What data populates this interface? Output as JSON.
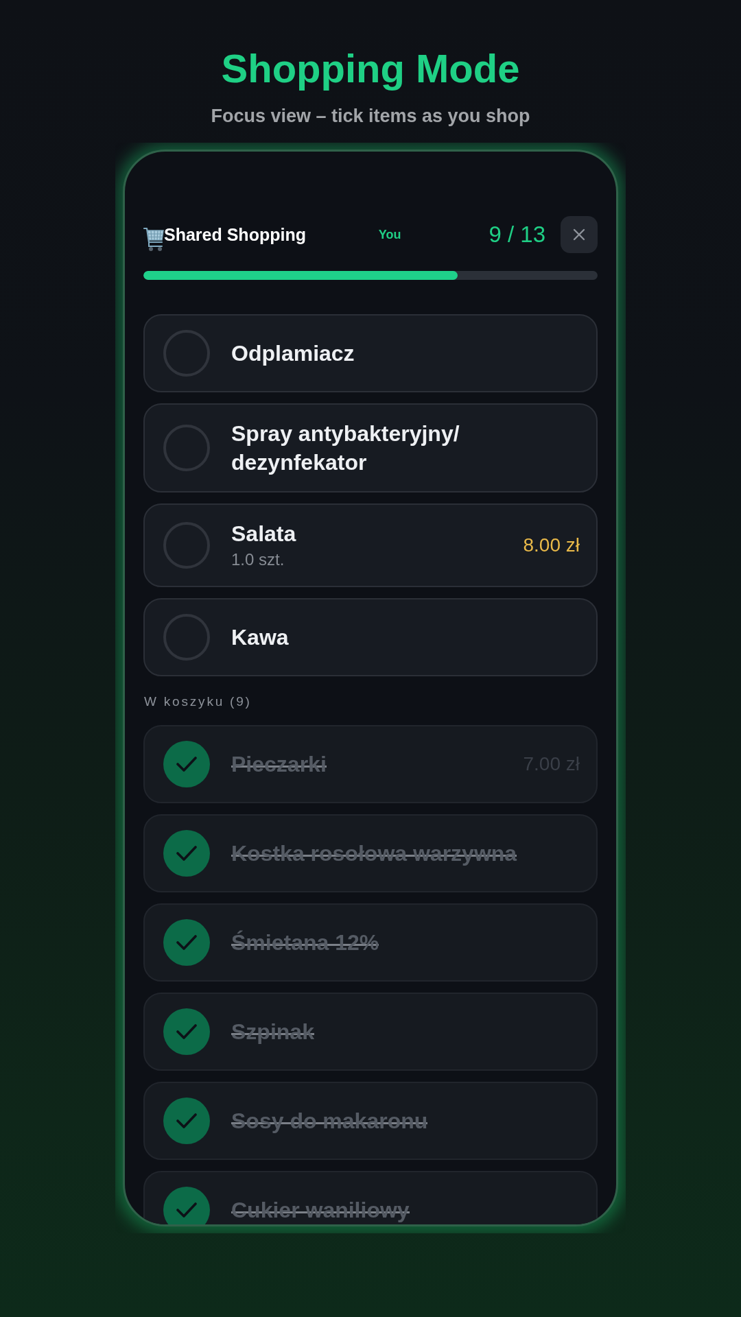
{
  "page": {
    "title": "Shopping Mode",
    "subtitle": "Focus view – tick items as you shop"
  },
  "header": {
    "title": "Shared Shopping",
    "user": "You",
    "count": "9 / 13",
    "progress": {
      "level": 0.692
    }
  },
  "to_buy": [
    {
      "name": "Odplamiacz",
      "checked": false
    },
    {
      "name": "Spray antybakteryjny/dezynfekator",
      "checked": false
    },
    {
      "name": "Salata",
      "quantity": "1.0 szt.",
      "price": "8.00 zł",
      "checked": false
    },
    {
      "name": "Kawa",
      "checked": false
    }
  ],
  "in_cart": {
    "label": "W koszyku (9)",
    "items": [
      {
        "name": "Pieczarki",
        "price": "7.00 zł",
        "checked": true
      },
      {
        "name": "Kostka rosołowa warzywna",
        "checked": true
      },
      {
        "name": "Śmietana 12%",
        "checked": true
      },
      {
        "name": "Szpinak",
        "checked": true
      },
      {
        "name": "Sosy do makaronu",
        "checked": true
      },
      {
        "name": "Cukier waniliowy",
        "checked": true
      }
    ]
  }
}
